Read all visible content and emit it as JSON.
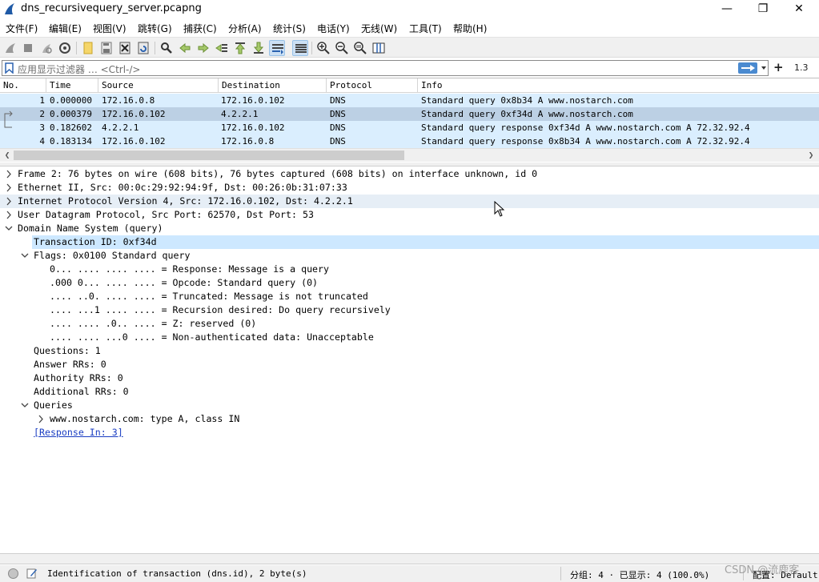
{
  "window": {
    "title": "dns_recursivequery_server.pcapng",
    "minimize": "—",
    "maximize": "❐",
    "close": "✕"
  },
  "menu": [
    "文件(F)",
    "编辑(E)",
    "视图(V)",
    "跳转(G)",
    "捕获(C)",
    "分析(A)",
    "统计(S)",
    "电话(Y)",
    "无线(W)",
    "工具(T)",
    "帮助(H)"
  ],
  "filter": {
    "placeholder": "应用显示过滤器 … <Ctrl-/>",
    "plus": "+",
    "version": "1.3"
  },
  "packet_list": {
    "columns": [
      "No.",
      "Time",
      "Source",
      "Destination",
      "Protocol",
      "Info"
    ],
    "rows": [
      {
        "no": "1",
        "time": "0.000000",
        "source": "172.16.0.8",
        "destination": "172.16.0.102",
        "protocol": "DNS",
        "info": "Standard query 0x8b34 A www.nostarch.com"
      },
      {
        "no": "2",
        "time": "0.000379",
        "source": "172.16.0.102",
        "destination": "4.2.2.1",
        "protocol": "DNS",
        "info": "Standard query 0xf34d A www.nostarch.com"
      },
      {
        "no": "3",
        "time": "0.182602",
        "source": "4.2.2.1",
        "destination": "172.16.0.102",
        "protocol": "DNS",
        "info": "Standard query response 0xf34d A www.nostarch.com A 72.32.92.4"
      },
      {
        "no": "4",
        "time": "0.183134",
        "source": "172.16.0.102",
        "destination": "172.16.0.8",
        "protocol": "DNS",
        "info": "Standard query response 0x8b34 A www.nostarch.com A 72.32.92.4"
      }
    ],
    "selected_row": 2
  },
  "details": [
    {
      "text": "Frame 2: 76 bytes on wire (608 bits), 76 bytes captured (608 bits) on interface unknown, id 0",
      "level": 0,
      "toggle": "collapsed"
    },
    {
      "text": "Ethernet II, Src: 00:0c:29:92:94:9f, Dst: 00:26:0b:31:07:33",
      "level": 0,
      "toggle": "collapsed"
    },
    {
      "text": "Internet Protocol Version 4, Src: 172.16.0.102, Dst: 4.2.2.1",
      "level": 0,
      "toggle": "collapsed"
    },
    {
      "text": "User Datagram Protocol, Src Port: 62570, Dst Port: 53",
      "level": 0,
      "toggle": "collapsed"
    },
    {
      "text": "Domain Name System (query)",
      "level": 0,
      "toggle": "expanded"
    },
    {
      "text": "Transaction ID: 0xf34d",
      "level": 1,
      "toggle": "none"
    },
    {
      "text": "Flags: 0x0100 Standard query",
      "level": 1,
      "toggle": "expanded"
    },
    {
      "text": "0... .... .... .... = Response: Message is a query",
      "level": 2,
      "toggle": "none"
    },
    {
      "text": ".000 0... .... .... = Opcode: Standard query (0)",
      "level": 2,
      "toggle": "none"
    },
    {
      "text": ".... ..0. .... .... = Truncated: Message is not truncated",
      "level": 2,
      "toggle": "none"
    },
    {
      "text": ".... ...1 .... .... = Recursion desired: Do query recursively",
      "level": 2,
      "toggle": "none"
    },
    {
      "text": ".... .... .0.. .... = Z: reserved (0)",
      "level": 2,
      "toggle": "none"
    },
    {
      "text": ".... .... ...0 .... = Non-authenticated data: Unacceptable",
      "level": 2,
      "toggle": "none"
    },
    {
      "text": "Questions: 1",
      "level": 1,
      "toggle": "none"
    },
    {
      "text": "Answer RRs: 0",
      "level": 1,
      "toggle": "none"
    },
    {
      "text": "Authority RRs: 0",
      "level": 1,
      "toggle": "none"
    },
    {
      "text": "Additional RRs: 0",
      "level": 1,
      "toggle": "none"
    },
    {
      "text": "Queries",
      "level": 1,
      "toggle": "expanded"
    },
    {
      "text": "www.nostarch.com: type A, class IN",
      "level": 2,
      "toggle": "collapsed"
    },
    {
      "text": "[Response In: 3]",
      "level": 1,
      "toggle": "none",
      "link": true
    }
  ],
  "status": {
    "field": "Identification of transaction (dns.id), 2 byte(s)",
    "packets": "分组: 4 · 已显示: 4 (100.0%)",
    "profile": "配置: Default"
  },
  "watermark": "CSDN @流鹿客",
  "colors": {
    "dns_row": "#daeefe",
    "selected_row": "#bcd0e4",
    "selected_field": "#cde8ff",
    "link": "#1a3dc2"
  }
}
